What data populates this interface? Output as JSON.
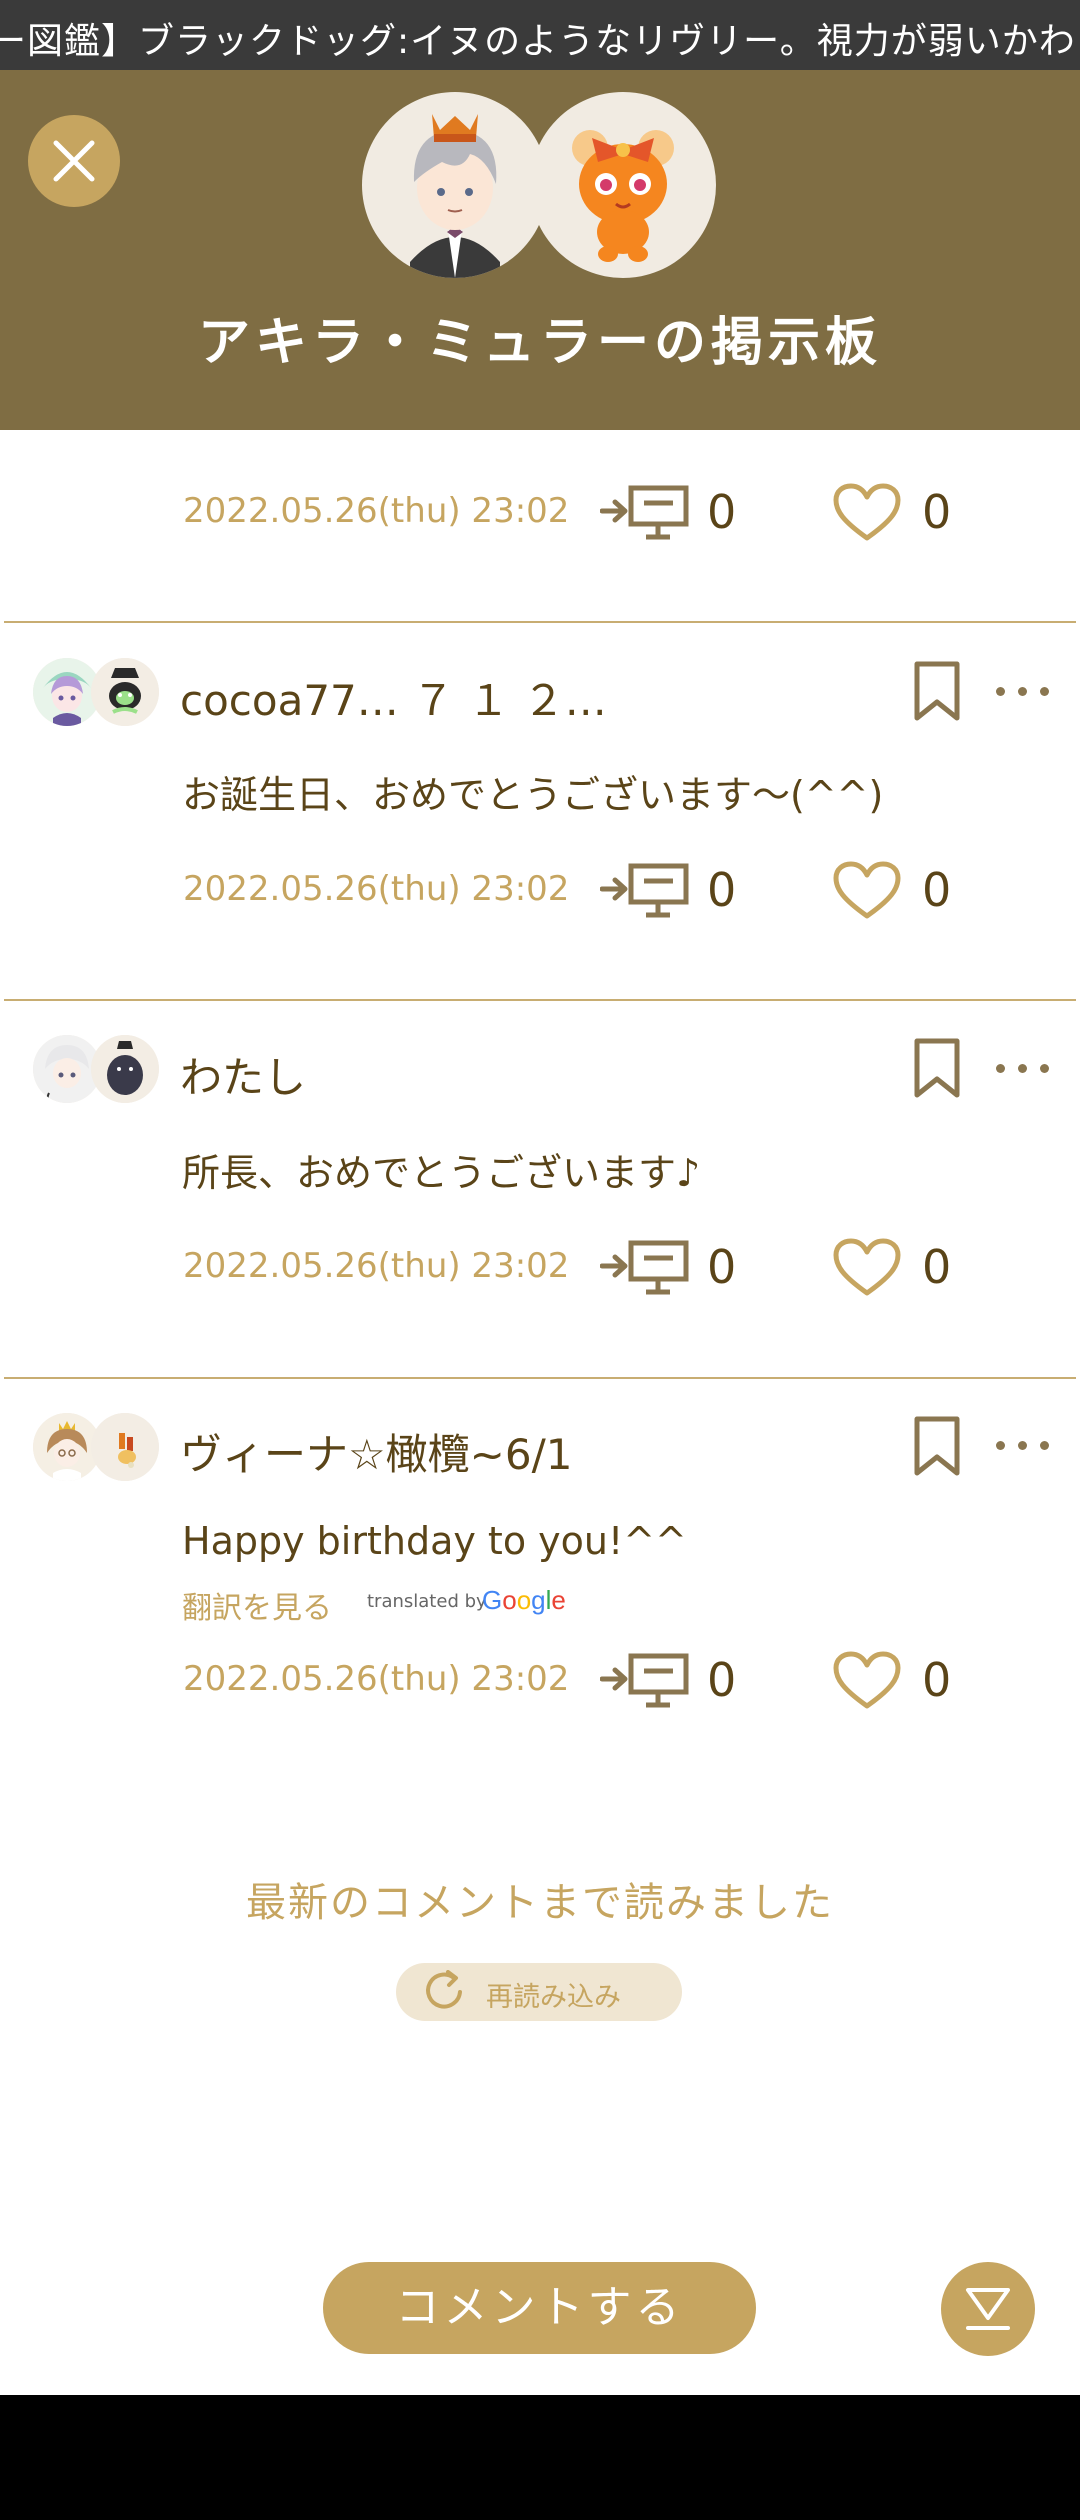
{
  "ticker": "ー図鑑】ブラックドッグ:イヌのようなリヴリー。視力が弱いかわりにに",
  "header": {
    "title": "アキラ・ミュラーの掲示板"
  },
  "posts": [
    {
      "date": "2022.05.26(thu) 23:02",
      "replies": "0",
      "likes": "0"
    },
    {
      "username": "cocoa77… ７ １ ２…",
      "message": "お誕生日、おめでとうございます〜(^^)",
      "date": "2022.05.26(thu) 23:02",
      "replies": "0",
      "likes": "0"
    },
    {
      "username": "わたし",
      "message": "所長、おめでとうございます♪",
      "date": "2022.05.26(thu) 23:02",
      "replies": "0",
      "likes": "0"
    },
    {
      "username": "ヴィーナ☆橄欖~6/1",
      "message": "Happy birthday to you!^^",
      "translate_link": "翻訳を見る",
      "translated_by": "translated by",
      "google": "Google",
      "date": "2022.05.26(thu) 23:02",
      "replies": "0",
      "likes": "0"
    }
  ],
  "footer": {
    "read_all": "最新のコメントまで読みました",
    "reload": "再読み込み",
    "comment_button": "コメントする"
  },
  "icons": {
    "close": "close-icon",
    "reply": "reply-board-icon",
    "like": "heart-icon",
    "bookmark": "bookmark-icon",
    "more": "more-dots-icon",
    "reload": "reload-icon",
    "scroll_bottom": "scroll-to-bottom-icon"
  },
  "colors": {
    "header_bg": "#7f6d43",
    "accent": "#c6a560",
    "text_brown": "#5a4418",
    "divider": "#c8ad72"
  }
}
